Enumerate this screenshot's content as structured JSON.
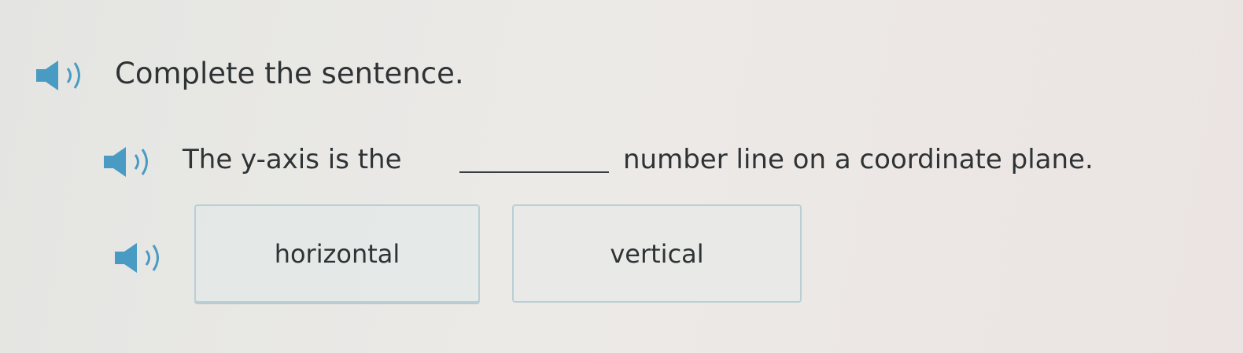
{
  "colors": {
    "icon": "#4a9bc4",
    "text": "#2f3335",
    "choice_border": "#b9cfd6"
  },
  "instruction": {
    "icon": "speaker-icon",
    "text": "Complete the sentence."
  },
  "question": {
    "icon": "speaker-icon",
    "text_before": "The y-axis is the",
    "text_after": "number line on a coordinate plane."
  },
  "choices": {
    "icon": "speaker-icon",
    "items": [
      {
        "label": "horizontal"
      },
      {
        "label": "vertical"
      }
    ]
  }
}
